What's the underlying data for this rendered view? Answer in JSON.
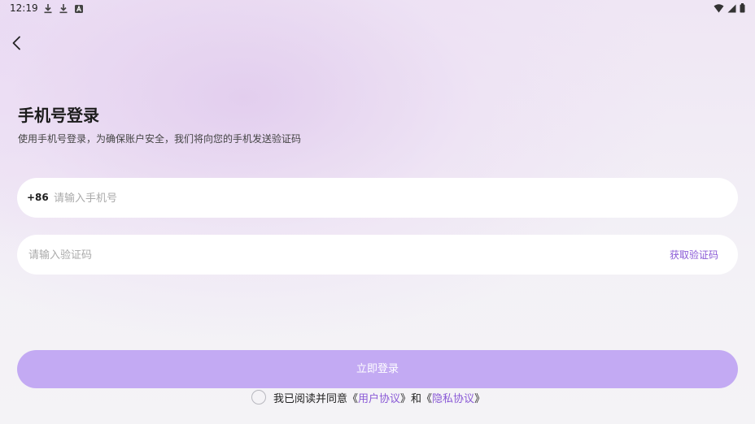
{
  "status_bar": {
    "time": "12:19",
    "left_icons": [
      "download-icon",
      "download-icon",
      "font-icon"
    ],
    "right_icons": [
      "wifi-icon",
      "signal-icon",
      "battery-icon"
    ]
  },
  "header": {
    "title": "手机号登录",
    "subtitle": "使用手机号登录，为确保账户安全，我们将向您的手机发送验证码"
  },
  "phone_field": {
    "prefix": "+86",
    "placeholder": "请输入手机号",
    "value": ""
  },
  "code_field": {
    "placeholder": "请输入验证码",
    "value": "",
    "get_code_label": "获取验证码"
  },
  "login_button": {
    "label": "立即登录"
  },
  "agreement": {
    "checked": false,
    "prefix": "我已阅读并同意《",
    "user_agreement": "用户协议",
    "middle": "》和《",
    "privacy_policy": "隐私协议",
    "suffix": "》"
  },
  "colors": {
    "accent": "#8a5ad6",
    "button": "#c3aaf3"
  }
}
